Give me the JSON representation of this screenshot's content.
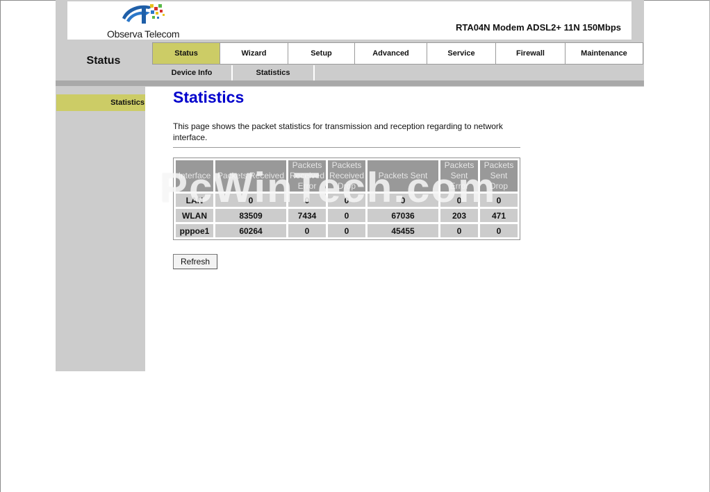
{
  "brand": {
    "name": "Observa Telecom"
  },
  "header": {
    "model_title": "RTA04N Modem ADSL2+ 11N 150Mbps"
  },
  "section_title": "Status",
  "main_nav": [
    {
      "label": "Status",
      "active": true
    },
    {
      "label": "Wizard",
      "active": false
    },
    {
      "label": "Setup",
      "active": false
    },
    {
      "label": "Advanced",
      "active": false
    },
    {
      "label": "Service",
      "active": false
    },
    {
      "label": "Firewall",
      "active": false
    },
    {
      "label": "Maintenance",
      "active": false
    }
  ],
  "sub_nav": [
    {
      "label": "Device Info"
    },
    {
      "label": "Statistics"
    }
  ],
  "sidebar": {
    "items": [
      {
        "label": "Statistics",
        "active": true
      }
    ]
  },
  "page": {
    "heading": "Statistics",
    "description": "This page shows the packet statistics for transmission and reception regarding to network interface."
  },
  "stats_table": {
    "headers": [
      "Interface",
      "Packets Received",
      "Packets Received Error",
      "Packets Received Drop",
      "Packets Sent",
      "Packets Sent Error",
      "Packets Sent Drop"
    ],
    "rows": [
      [
        "LAN",
        "0",
        "0",
        "0",
        "0",
        "0",
        "0"
      ],
      [
        "WLAN",
        "83509",
        "7434",
        "0",
        "67036",
        "203",
        "471"
      ],
      [
        "pppoe1",
        "60264",
        "0",
        "0",
        "45455",
        "0",
        "0"
      ]
    ]
  },
  "buttons": {
    "refresh": "Refresh"
  },
  "watermark": "PcWinTech.com",
  "colors": {
    "active_tab": "#cccc66",
    "heading": "#0000cc",
    "table_header": "#999999",
    "table_cell": "#cccccc"
  }
}
